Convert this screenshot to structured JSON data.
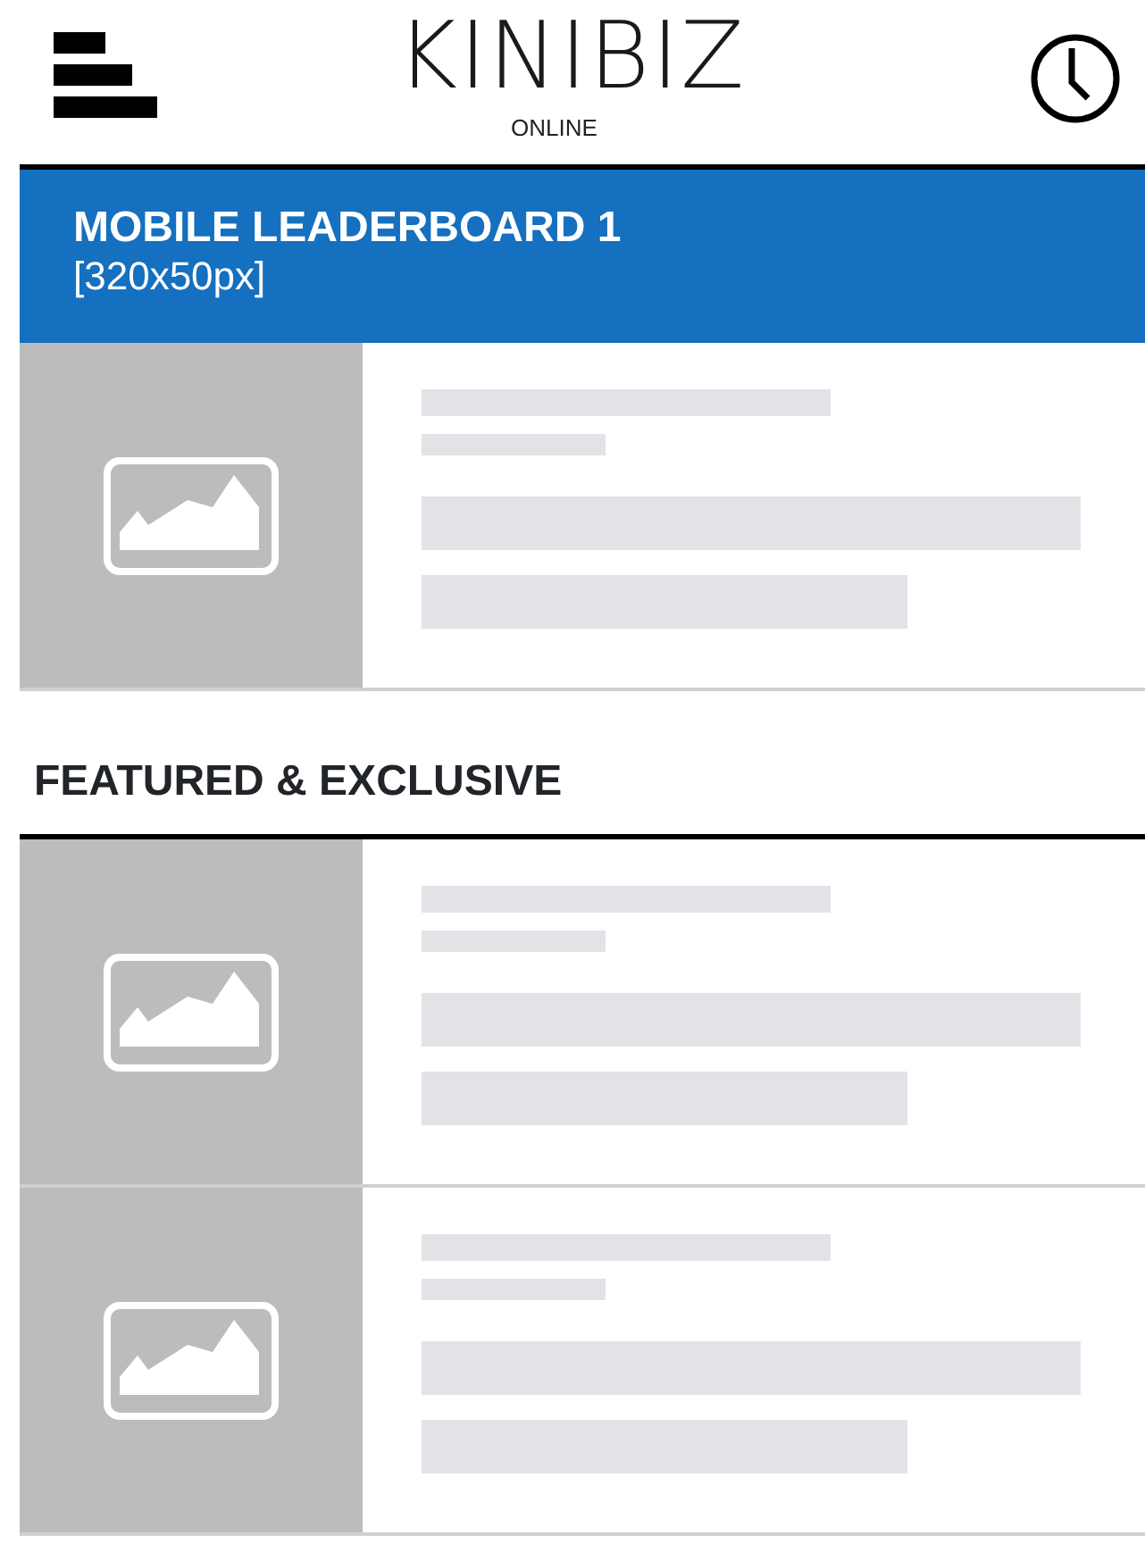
{
  "header": {
    "logo": "KINIBIZ",
    "logo_subtitle": "ONLINE"
  },
  "ad_banner": {
    "title": "MOBILE LEADERBOARD 1",
    "size": "[320x50px]"
  },
  "top_cards": [
    {
      "kind": "placeholder"
    }
  ],
  "section": {
    "title": "FEATURED & EXCLUSIVE"
  },
  "section_cards": [
    {
      "kind": "placeholder"
    },
    {
      "kind": "placeholder"
    }
  ]
}
